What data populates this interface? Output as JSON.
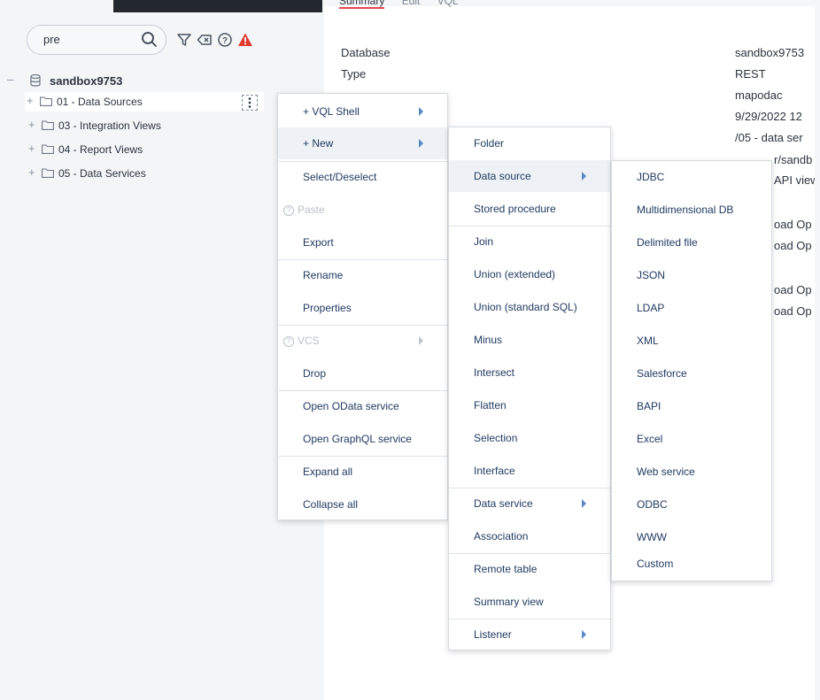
{
  "top_tabs": [
    "Summary",
    "Edit",
    "VQL"
  ],
  "search": {
    "value": "pre"
  },
  "tree": {
    "root": "sandbox9753",
    "items": [
      {
        "label": "01 - Data Sources"
      },
      {
        "label": "03 - Integration Views"
      },
      {
        "label": "04 - Report Views"
      },
      {
        "label": "05 - Data Services"
      }
    ]
  },
  "info": {
    "labels": [
      "Database",
      "Type"
    ],
    "values": [
      "sandbox9753",
      "REST",
      "mapodac",
      "9/29/2022 12",
      "/05 - data ser",
      ""
    ],
    "partials": [
      "r/sandb",
      "API view",
      "oad Op",
      "oad Op",
      "oad Op",
      "oad Op"
    ]
  },
  "context_menu": {
    "items": [
      {
        "label": "+ VQL Shell"
      },
      {
        "label": "+ New"
      },
      {
        "label": "Select/Deselect"
      },
      {
        "label": "Paste"
      },
      {
        "label": "Export"
      },
      {
        "label": "Rename"
      },
      {
        "label": "Properties"
      },
      {
        "label": "VCS"
      },
      {
        "label": "Drop"
      },
      {
        "label": "Open OData service"
      },
      {
        "label": "Open GraphQL service"
      },
      {
        "label": "Expand all"
      },
      {
        "label": "Collapse all"
      }
    ]
  },
  "new_menu": {
    "items": [
      {
        "label": "Folder"
      },
      {
        "label": "Data source"
      },
      {
        "label": "Stored procedure"
      },
      {
        "label": "Join"
      },
      {
        "label": "Union (extended)"
      },
      {
        "label": "Union (standard SQL)"
      },
      {
        "label": "Minus"
      },
      {
        "label": "Intersect"
      },
      {
        "label": "Flatten"
      },
      {
        "label": "Selection"
      },
      {
        "label": "Interface"
      },
      {
        "label": "Data service"
      },
      {
        "label": "Association"
      },
      {
        "label": "Remote table"
      },
      {
        "label": "Summary view"
      },
      {
        "label": "Listener"
      }
    ]
  },
  "datasource_menu": {
    "items": [
      {
        "label": "JDBC"
      },
      {
        "label": "Multidimensional DB"
      },
      {
        "label": "Delimited file"
      },
      {
        "label": "JSON"
      },
      {
        "label": "LDAP"
      },
      {
        "label": "XML"
      },
      {
        "label": "Salesforce"
      },
      {
        "label": "BAPI"
      },
      {
        "label": "Excel"
      },
      {
        "label": "Web service"
      },
      {
        "label": "ODBC"
      },
      {
        "label": "WWW"
      },
      {
        "label": "Custom"
      }
    ]
  },
  "colors": {
    "accent": "#e5484d",
    "menu_text": "#1f3b62",
    "arrow": "#5a87c5",
    "warning": "#e03a2f"
  }
}
